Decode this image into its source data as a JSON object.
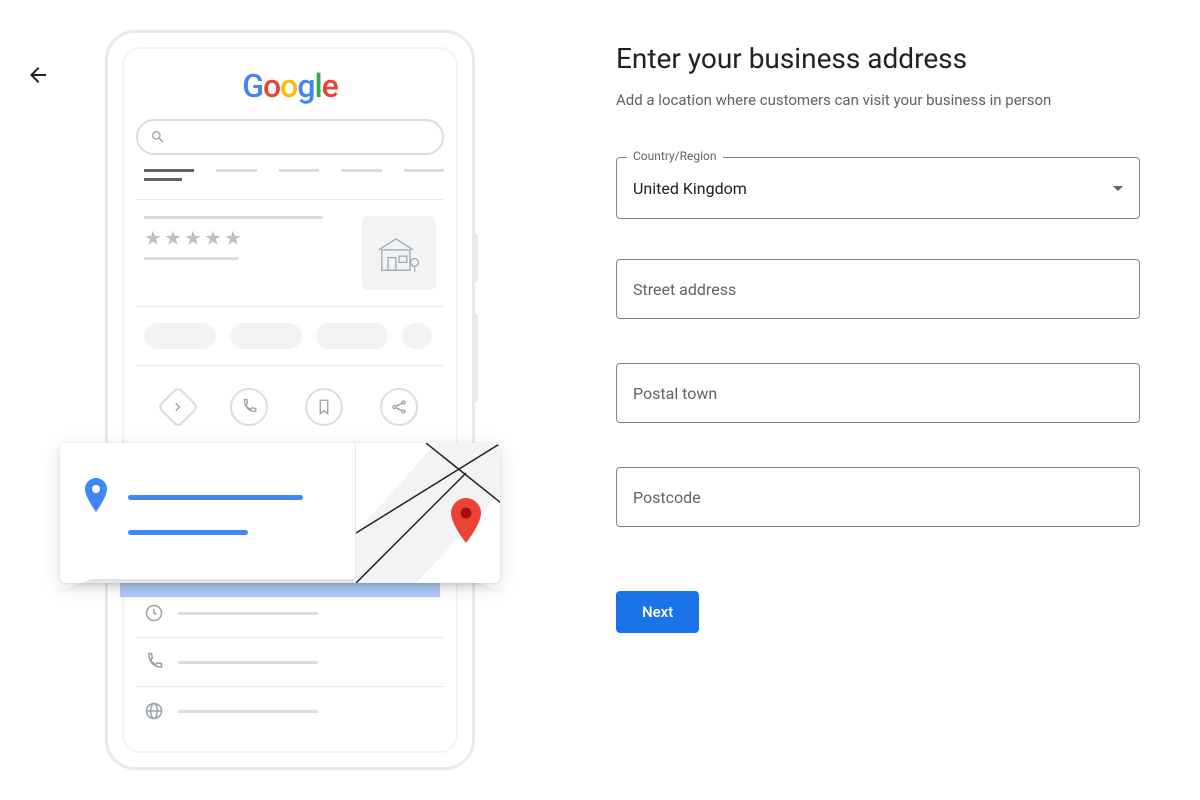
{
  "heading": "Enter your business address",
  "subheading": "Add a location where customers can visit your business in person",
  "form": {
    "country_label": "Country/Region",
    "country_value": "United Kingdom",
    "street_placeholder": "Street address",
    "town_placeholder": "Postal town",
    "postcode_placeholder": "Postcode",
    "next_label": "Next"
  },
  "logo": {
    "letters": [
      "G",
      "o",
      "o",
      "g",
      "l",
      "e"
    ]
  }
}
